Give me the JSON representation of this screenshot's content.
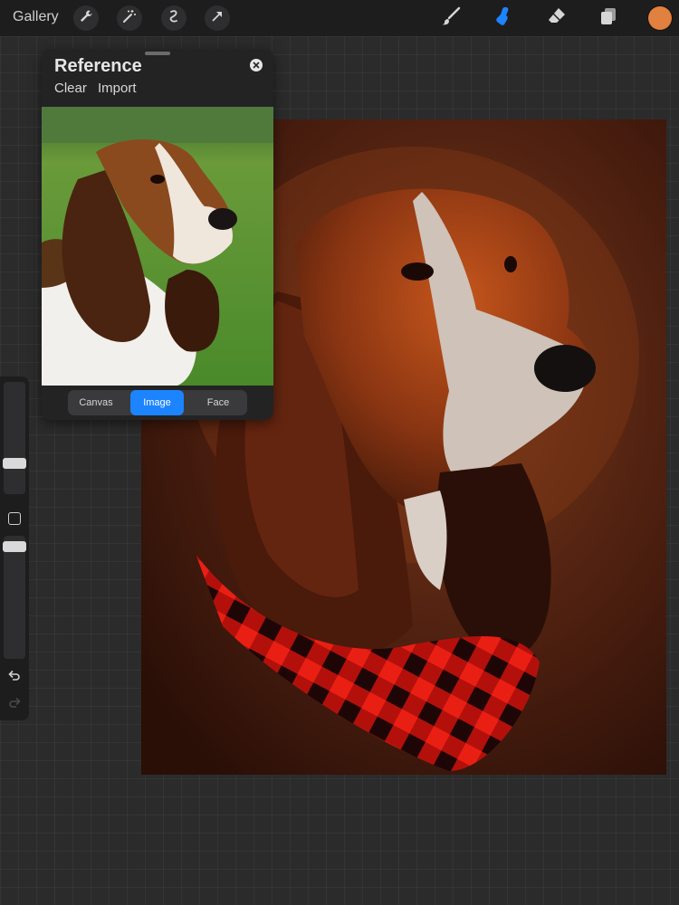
{
  "toolbar": {
    "gallery_label": "Gallery",
    "left_tools": [
      "wrench-icon",
      "magic-wand-icon",
      "selection-icon",
      "transform-arrow-icon"
    ],
    "right_tools": [
      "brush-icon",
      "smudge-icon",
      "eraser-icon",
      "layers-icon"
    ],
    "active_tool": "smudge-icon",
    "accent_color": "#1c84ff",
    "current_color": "#e1803f"
  },
  "reference_panel": {
    "title": "Reference",
    "actions": {
      "clear": "Clear",
      "import": "Import"
    },
    "modes": [
      "Canvas",
      "Image",
      "Face"
    ],
    "active_mode": "Image"
  },
  "sidebar": {
    "brush_size": 0.25,
    "opacity": 0.95,
    "icons": [
      "modify-button",
      "undo-icon",
      "redo-icon"
    ]
  }
}
